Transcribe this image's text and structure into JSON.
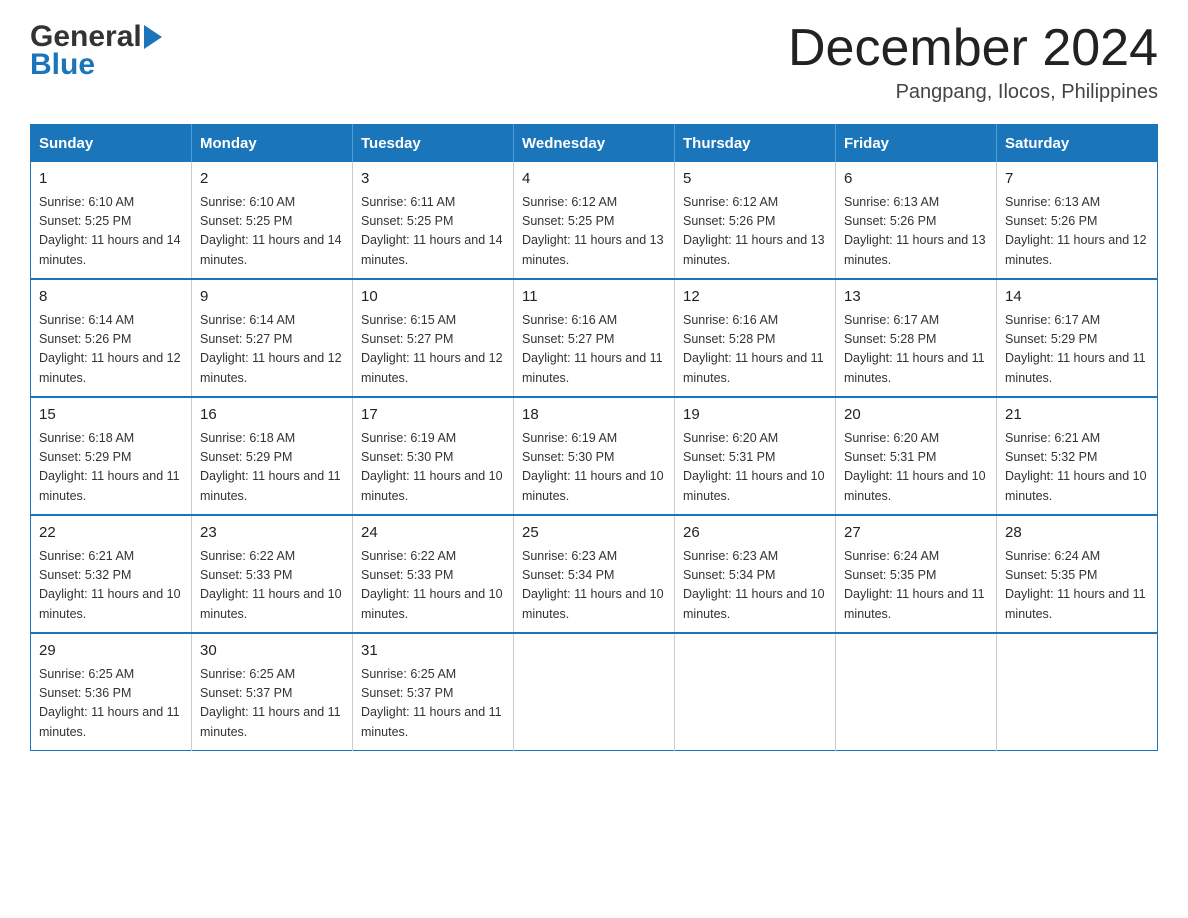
{
  "header": {
    "logo_general": "General",
    "logo_blue": "Blue",
    "main_title": "December 2024",
    "subtitle": "Pangpang, Ilocos, Philippines"
  },
  "calendar": {
    "days_of_week": [
      "Sunday",
      "Monday",
      "Tuesday",
      "Wednesday",
      "Thursday",
      "Friday",
      "Saturday"
    ],
    "weeks": [
      [
        {
          "day": "1",
          "sunrise": "6:10 AM",
          "sunset": "5:25 PM",
          "daylight": "11 hours and 14 minutes."
        },
        {
          "day": "2",
          "sunrise": "6:10 AM",
          "sunset": "5:25 PM",
          "daylight": "11 hours and 14 minutes."
        },
        {
          "day": "3",
          "sunrise": "6:11 AM",
          "sunset": "5:25 PM",
          "daylight": "11 hours and 14 minutes."
        },
        {
          "day": "4",
          "sunrise": "6:12 AM",
          "sunset": "5:25 PM",
          "daylight": "11 hours and 13 minutes."
        },
        {
          "day": "5",
          "sunrise": "6:12 AM",
          "sunset": "5:26 PM",
          "daylight": "11 hours and 13 minutes."
        },
        {
          "day": "6",
          "sunrise": "6:13 AM",
          "sunset": "5:26 PM",
          "daylight": "11 hours and 13 minutes."
        },
        {
          "day": "7",
          "sunrise": "6:13 AM",
          "sunset": "5:26 PM",
          "daylight": "11 hours and 12 minutes."
        }
      ],
      [
        {
          "day": "8",
          "sunrise": "6:14 AM",
          "sunset": "5:26 PM",
          "daylight": "11 hours and 12 minutes."
        },
        {
          "day": "9",
          "sunrise": "6:14 AM",
          "sunset": "5:27 PM",
          "daylight": "11 hours and 12 minutes."
        },
        {
          "day": "10",
          "sunrise": "6:15 AM",
          "sunset": "5:27 PM",
          "daylight": "11 hours and 12 minutes."
        },
        {
          "day": "11",
          "sunrise": "6:16 AM",
          "sunset": "5:27 PM",
          "daylight": "11 hours and 11 minutes."
        },
        {
          "day": "12",
          "sunrise": "6:16 AM",
          "sunset": "5:28 PM",
          "daylight": "11 hours and 11 minutes."
        },
        {
          "day": "13",
          "sunrise": "6:17 AM",
          "sunset": "5:28 PM",
          "daylight": "11 hours and 11 minutes."
        },
        {
          "day": "14",
          "sunrise": "6:17 AM",
          "sunset": "5:29 PM",
          "daylight": "11 hours and 11 minutes."
        }
      ],
      [
        {
          "day": "15",
          "sunrise": "6:18 AM",
          "sunset": "5:29 PM",
          "daylight": "11 hours and 11 minutes."
        },
        {
          "day": "16",
          "sunrise": "6:18 AM",
          "sunset": "5:29 PM",
          "daylight": "11 hours and 11 minutes."
        },
        {
          "day": "17",
          "sunrise": "6:19 AM",
          "sunset": "5:30 PM",
          "daylight": "11 hours and 10 minutes."
        },
        {
          "day": "18",
          "sunrise": "6:19 AM",
          "sunset": "5:30 PM",
          "daylight": "11 hours and 10 minutes."
        },
        {
          "day": "19",
          "sunrise": "6:20 AM",
          "sunset": "5:31 PM",
          "daylight": "11 hours and 10 minutes."
        },
        {
          "day": "20",
          "sunrise": "6:20 AM",
          "sunset": "5:31 PM",
          "daylight": "11 hours and 10 minutes."
        },
        {
          "day": "21",
          "sunrise": "6:21 AM",
          "sunset": "5:32 PM",
          "daylight": "11 hours and 10 minutes."
        }
      ],
      [
        {
          "day": "22",
          "sunrise": "6:21 AM",
          "sunset": "5:32 PM",
          "daylight": "11 hours and 10 minutes."
        },
        {
          "day": "23",
          "sunrise": "6:22 AM",
          "sunset": "5:33 PM",
          "daylight": "11 hours and 10 minutes."
        },
        {
          "day": "24",
          "sunrise": "6:22 AM",
          "sunset": "5:33 PM",
          "daylight": "11 hours and 10 minutes."
        },
        {
          "day": "25",
          "sunrise": "6:23 AM",
          "sunset": "5:34 PM",
          "daylight": "11 hours and 10 minutes."
        },
        {
          "day": "26",
          "sunrise": "6:23 AM",
          "sunset": "5:34 PM",
          "daylight": "11 hours and 10 minutes."
        },
        {
          "day": "27",
          "sunrise": "6:24 AM",
          "sunset": "5:35 PM",
          "daylight": "11 hours and 11 minutes."
        },
        {
          "day": "28",
          "sunrise": "6:24 AM",
          "sunset": "5:35 PM",
          "daylight": "11 hours and 11 minutes."
        }
      ],
      [
        {
          "day": "29",
          "sunrise": "6:25 AM",
          "sunset": "5:36 PM",
          "daylight": "11 hours and 11 minutes."
        },
        {
          "day": "30",
          "sunrise": "6:25 AM",
          "sunset": "5:37 PM",
          "daylight": "11 hours and 11 minutes."
        },
        {
          "day": "31",
          "sunrise": "6:25 AM",
          "sunset": "5:37 PM",
          "daylight": "11 hours and 11 minutes."
        },
        null,
        null,
        null,
        null
      ]
    ]
  }
}
